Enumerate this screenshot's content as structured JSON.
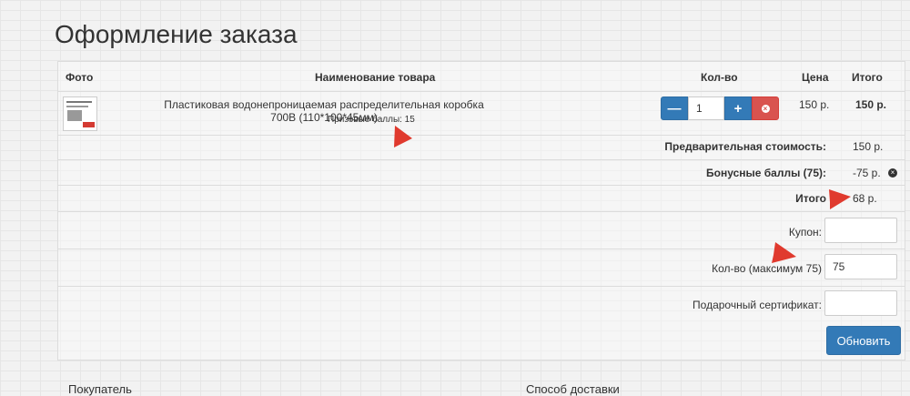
{
  "page": {
    "title": "Оформление заказа"
  },
  "table": {
    "headers": {
      "photo": "Фото",
      "name": "Наименование товара",
      "qty": "Кол-во",
      "price": "Цена",
      "total": "Итого"
    },
    "item": {
      "name": "Пластиковая водонепроницаемая распределительная коробка 700В (110*100*45мм)",
      "bonus": "Призовые баллы: 15",
      "qty": "1",
      "price": "150 р.",
      "total": "150 р."
    }
  },
  "summary": {
    "subtotal": {
      "label": "Предварительная стоимость:",
      "value": "150 р."
    },
    "bonus_points": {
      "label": "Бонусные баллы (75):",
      "value": "-75 р."
    },
    "total": {
      "label": "Итого",
      "value": "68 р."
    }
  },
  "form": {
    "coupon": {
      "label": "Купон:",
      "value": ""
    },
    "points": {
      "label": "Кол-во (максимум 75)",
      "value": "75"
    },
    "voucher": {
      "label": "Подарочный сертификат:",
      "value": ""
    },
    "update_label": "Обновить"
  },
  "sections": {
    "buyer": "Покупатель",
    "shipping": "Способ доставки"
  },
  "colors": {
    "primary": "#337ab7",
    "danger": "#d9534f",
    "annotation_arrow": "#e03a2e"
  },
  "icons": {
    "minus": "minus-icon",
    "plus": "plus-icon",
    "remove": "remove-icon",
    "remove_bonus": "remove-circle-icon"
  }
}
